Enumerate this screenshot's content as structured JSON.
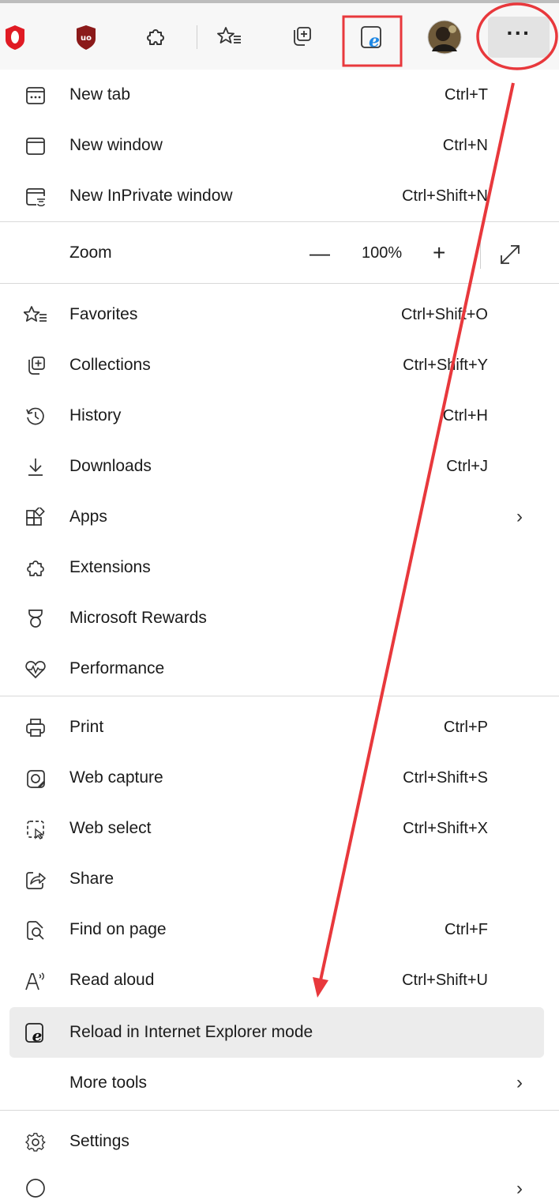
{
  "toolbar": {
    "icons": [
      "opera-icon",
      "ublock-icon",
      "extensions-icon",
      "favorites-icon",
      "collections-icon",
      "ie-mode-icon",
      "profile-avatar",
      "more-icon"
    ],
    "more_label": "···"
  },
  "menu": {
    "new_tab": {
      "label": "New tab",
      "shortcut": "Ctrl+T"
    },
    "new_window": {
      "label": "New window",
      "shortcut": "Ctrl+N"
    },
    "new_inprivate": {
      "label": "New InPrivate window",
      "shortcut": "Ctrl+Shift+N"
    },
    "zoom": {
      "label": "Zoom",
      "minus": "—",
      "value": "100%",
      "plus": "+"
    },
    "favorites": {
      "label": "Favorites",
      "shortcut": "Ctrl+Shift+O"
    },
    "collections": {
      "label": "Collections",
      "shortcut": "Ctrl+Shift+Y"
    },
    "history": {
      "label": "History",
      "shortcut": "Ctrl+H"
    },
    "downloads": {
      "label": "Downloads",
      "shortcut": "Ctrl+J"
    },
    "apps": {
      "label": "Apps",
      "chevron": "›"
    },
    "extensions": {
      "label": "Extensions"
    },
    "rewards": {
      "label": "Microsoft Rewards"
    },
    "performance": {
      "label": "Performance"
    },
    "print": {
      "label": "Print",
      "shortcut": "Ctrl+P"
    },
    "web_capture": {
      "label": "Web capture",
      "shortcut": "Ctrl+Shift+S"
    },
    "web_select": {
      "label": "Web select",
      "shortcut": "Ctrl+Shift+X"
    },
    "share": {
      "label": "Share"
    },
    "find": {
      "label": "Find on page",
      "shortcut": "Ctrl+F"
    },
    "read_aloud": {
      "label": "Read aloud",
      "shortcut": "Ctrl+Shift+U"
    },
    "ie_mode": {
      "label": "Reload in Internet Explorer mode"
    },
    "more_tools": {
      "label": "More tools",
      "chevron": "›"
    },
    "settings": {
      "label": "Settings"
    }
  },
  "colors": {
    "annotation_red": "#e8383c",
    "ie_blue": "#1e88e5",
    "opera_red": "#e01b24",
    "ublock_red": "#8b1a1a",
    "highlight_bg": "#ececec"
  }
}
